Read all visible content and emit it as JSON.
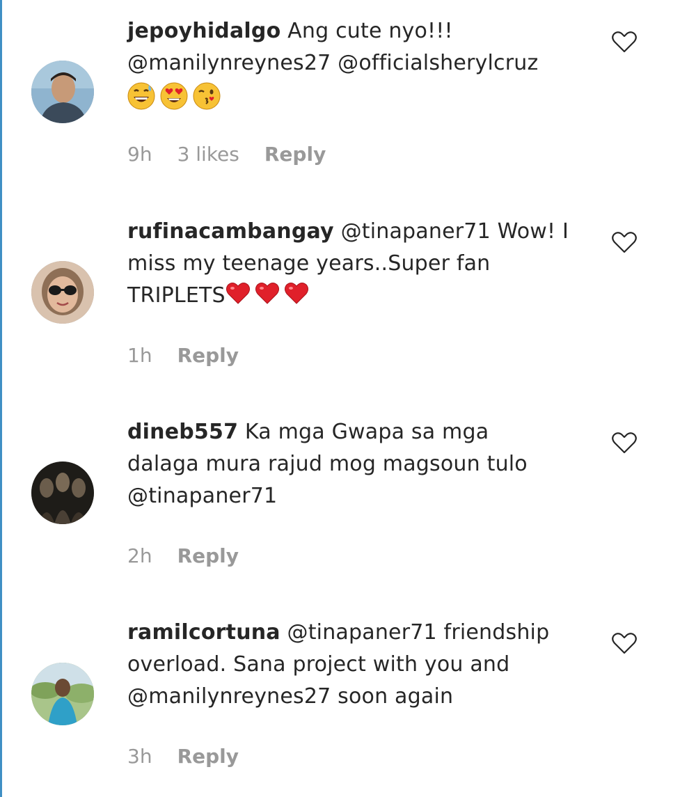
{
  "comments": [
    {
      "username": "jepoyhidalgo",
      "text_line1": "Ang cute nyo!!!",
      "text_line2": "@manilynreynes27 @officialsherylcruz",
      "emojis": [
        "grinning-sweat-emoji",
        "heart-eyes-emoji",
        "kissing-wink-emoji"
      ],
      "time": "9h",
      "likes": "3 likes",
      "reply_label": "Reply"
    },
    {
      "username": "rufinacambangay",
      "text_line1": "@tinapaner71 Wow! I",
      "text_line2": "miss my teenage years..Super fan",
      "text_line3": "TRIPLETS",
      "emojis": [
        "red-heart-emoji",
        "red-heart-emoji",
        "red-heart-emoji"
      ],
      "time": "1h",
      "reply_label": "Reply"
    },
    {
      "username": "dineb557",
      "text_line1": "Ka mga Gwapa sa mga",
      "text_line2": "dalaga mura rajud mog magsoun tulo",
      "text_line3": "@tinapaner71",
      "time": "2h",
      "reply_label": "Reply"
    },
    {
      "username": "ramilcortuna",
      "text_line1": "@tinapaner71 friendship",
      "text_line2": "overload. Sana project with you and",
      "text_line3": "@manilynreynes27 soon again",
      "time": "3h",
      "reply_label": "Reply"
    }
  ],
  "colors": {
    "text": "#262626",
    "meta": "#999999",
    "heart_red": "#e0202a",
    "left_rule": "#3f8fc4"
  }
}
